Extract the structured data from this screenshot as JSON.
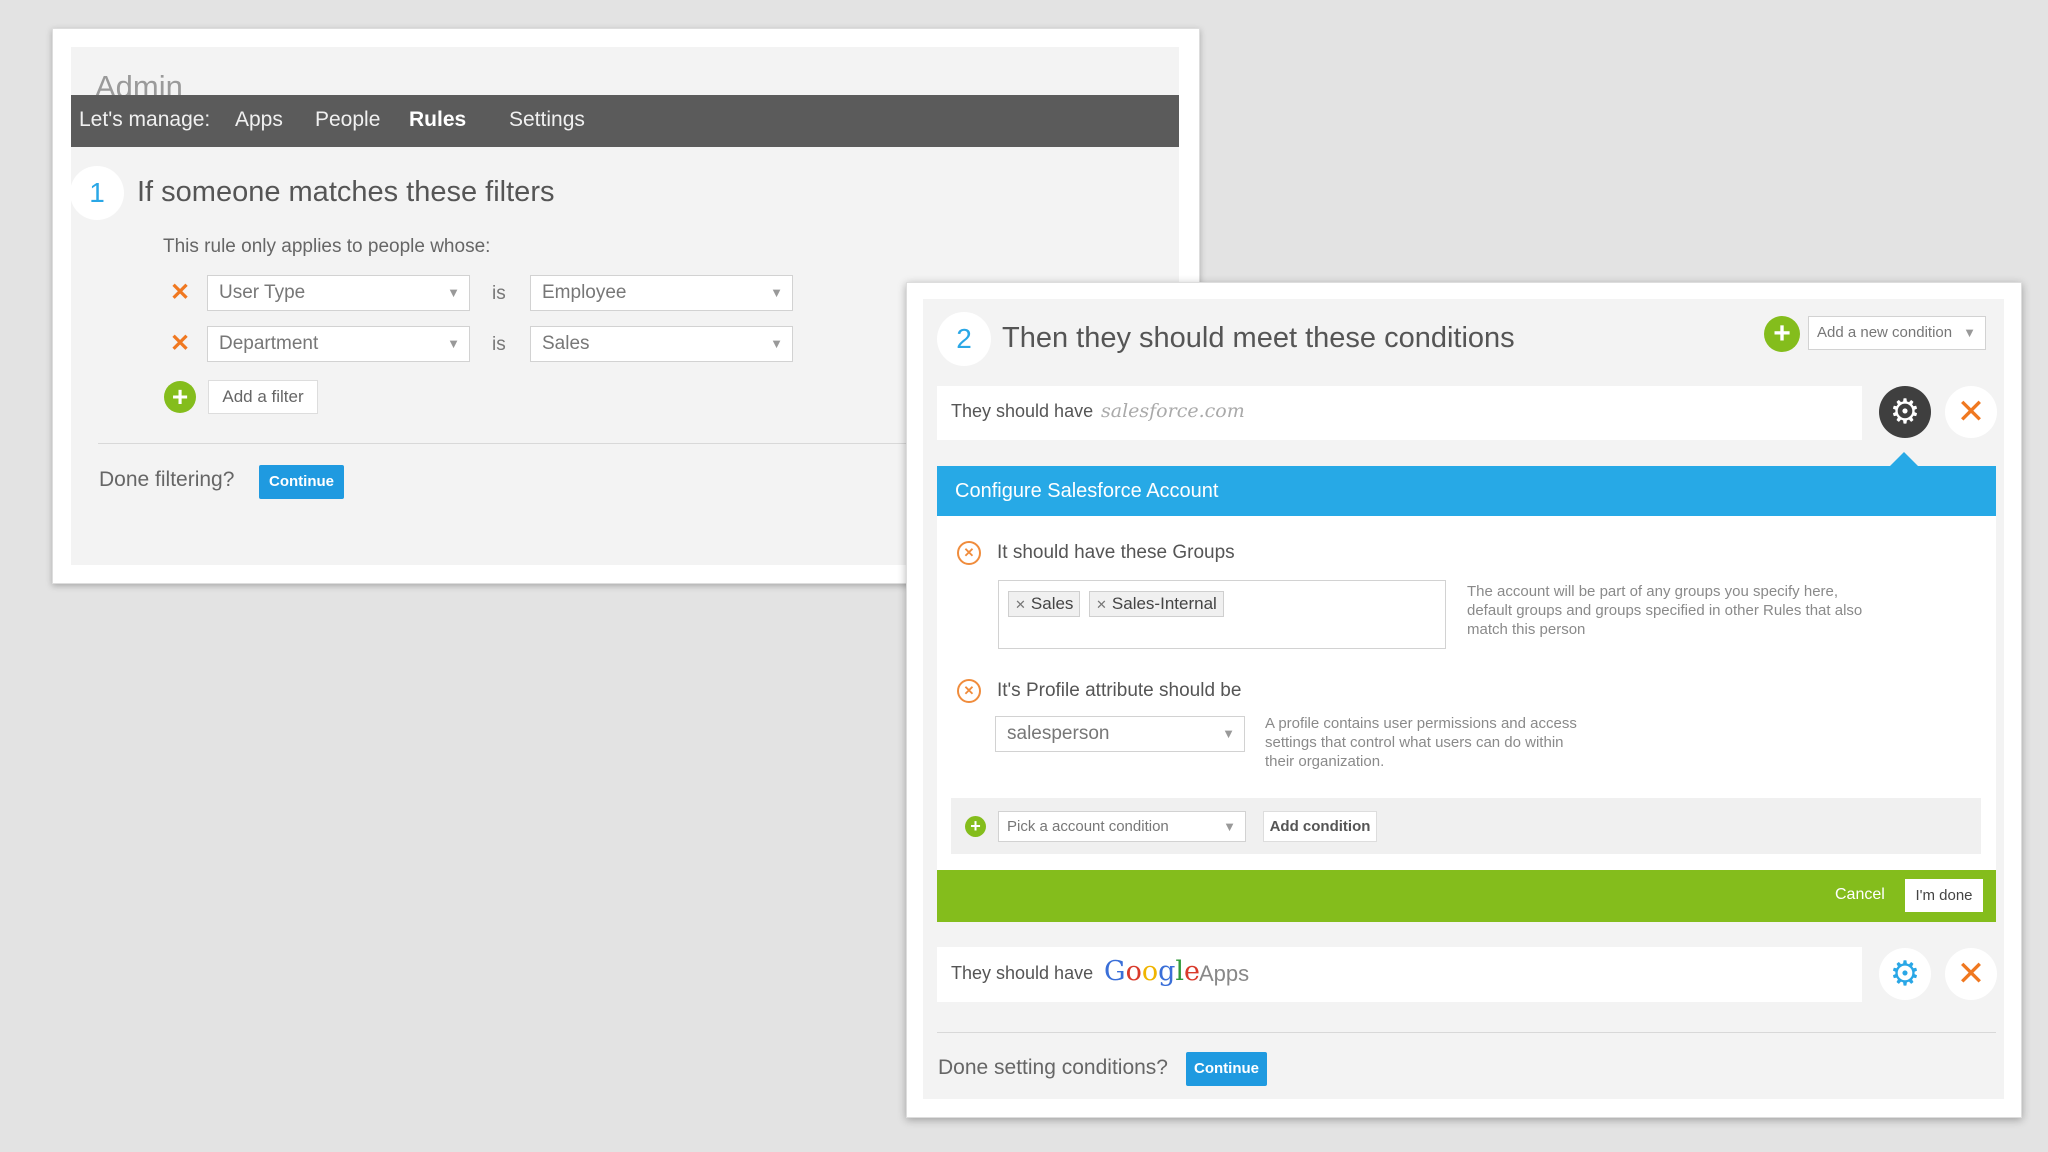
{
  "admin": {
    "title": "Admin",
    "nav": {
      "prefix": "Let's manage:",
      "items": [
        "Apps",
        "People",
        "Rules",
        "Settings"
      ],
      "active": "Rules"
    }
  },
  "step1": {
    "number": "1",
    "heading": "If someone matches these filters",
    "intro": "This rule only applies to people whose:",
    "filters": [
      {
        "field": "User Type",
        "operator": "is",
        "value": "Employee"
      },
      {
        "field": "Department",
        "operator": "is",
        "value": "Sales"
      }
    ],
    "add_filter_label": "Add a filter",
    "done_prompt": "Done filtering?",
    "continue_label": "Continue"
  },
  "step2": {
    "number": "2",
    "heading": "Then they should meet these conditions",
    "add_condition_select": "Add a new condition",
    "conditions": [
      {
        "prefix": "They should have",
        "app": "salesforce.com"
      },
      {
        "prefix": "They should have",
        "app_google": "Google",
        "app_suffix": "Apps"
      }
    ],
    "config": {
      "title": "Configure Salesforce Account",
      "groups_heading": "It should have these Groups",
      "groups": [
        "Sales",
        "Sales-Internal"
      ],
      "groups_help_lines": [
        "The account will be part of any groups you specify here,",
        "default groups and groups specified in other Rules that also",
        "match this person"
      ],
      "profile_heading": "It's Profile attribute should be",
      "profile_value": "salesperson",
      "profile_help_lines": [
        "A profile contains user permissions and access",
        "settings that control what users can do within",
        "their organization."
      ],
      "pick_condition_placeholder": "Pick a account condition",
      "add_condition_label": "Add condition",
      "cancel_label": "Cancel",
      "done_label": "I'm done"
    },
    "done_prompt": "Done setting conditions?",
    "continue_label": "Continue"
  },
  "colors": {
    "accent_blue": "#27a9e6",
    "button_blue": "#1f9ae0",
    "green": "#84bd1c",
    "orange": "#f07820",
    "nav_bg": "#5b5b5b"
  }
}
